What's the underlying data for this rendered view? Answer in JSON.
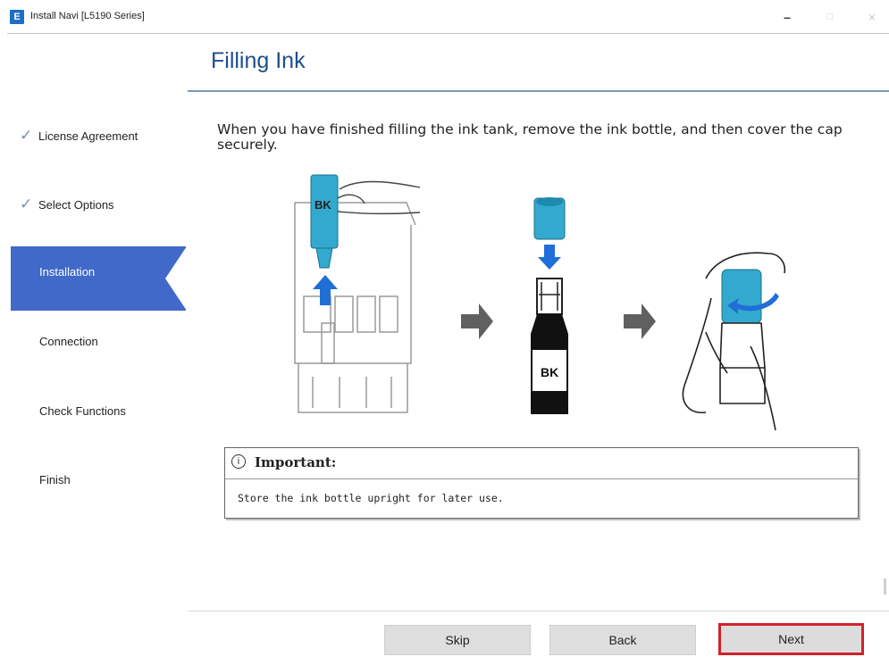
{
  "window": {
    "app_icon": "E",
    "title": "Install Navi [L5190 Series]",
    "controls": {
      "minimize": "–",
      "maximize": "□",
      "close": "×"
    }
  },
  "page": {
    "title": "Filling Ink",
    "instruction": "When you have finished filling the ink tank, remove the ink bottle, and then cover the cap securely."
  },
  "sidebar": {
    "steps": [
      {
        "label": "License Agreement",
        "state": "done",
        "check": "✓"
      },
      {
        "label": "Select Options",
        "state": "done",
        "check": "✓"
      },
      {
        "label": "Installation",
        "state": "active"
      },
      {
        "label": "Connection",
        "state": "pending"
      },
      {
        "label": "Check Functions",
        "state": "pending"
      },
      {
        "label": "Finish",
        "state": "pending"
      }
    ]
  },
  "illustration": {
    "bottle_label": "BK",
    "accent_color": "#33a9cf",
    "arrow_color": "#1f6fd6"
  },
  "important": {
    "icon": "i",
    "title": "Important:",
    "text": "Store the ink bottle upright for later use."
  },
  "buttons": {
    "skip": "Skip",
    "back": "Back",
    "next": "Next"
  },
  "colors": {
    "active_step": "#4169c9",
    "title": "#1c4f8a",
    "next_highlight": "#d4202a"
  }
}
